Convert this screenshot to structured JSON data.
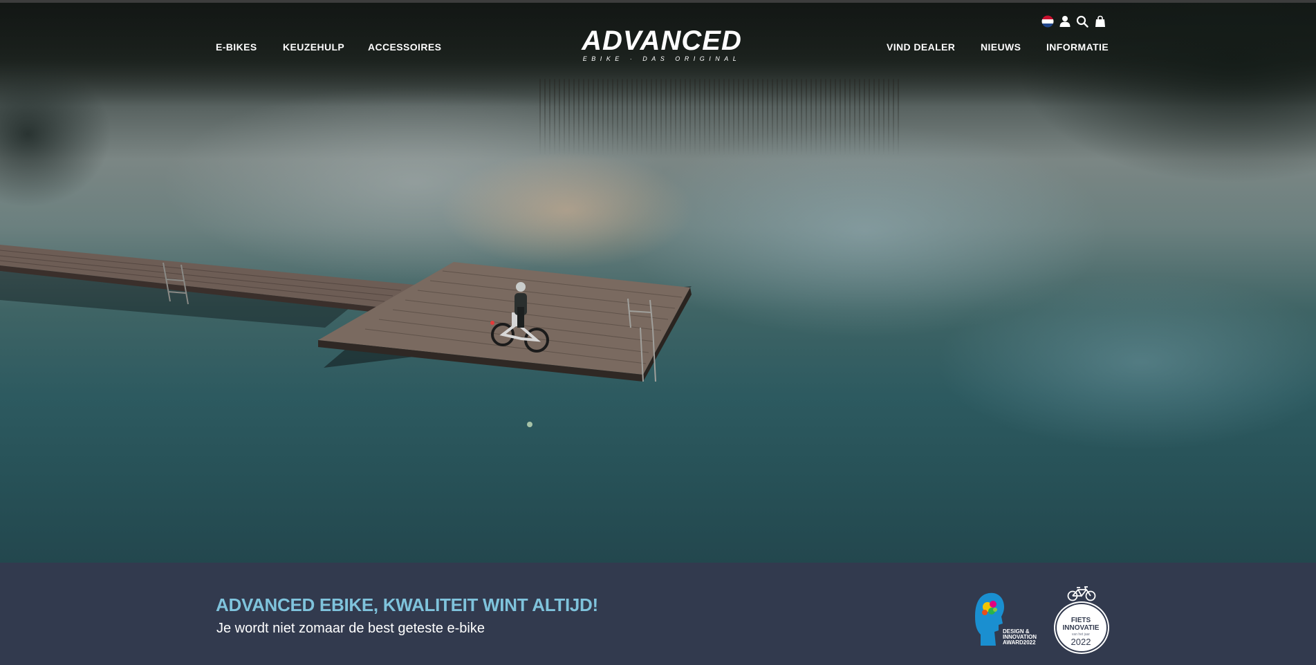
{
  "nav": {
    "left": [
      {
        "label": "E-BIKES"
      },
      {
        "label": "KEUZEHULP"
      },
      {
        "label": "ACCESSOIRES"
      }
    ],
    "right": [
      {
        "label": "VIND DEALER"
      },
      {
        "label": "NIEUWS"
      },
      {
        "label": "INFORMATIE"
      }
    ]
  },
  "logo": {
    "wordmark": "ADVANCED",
    "tagline": "EBIKE · DAS ORIGINAL"
  },
  "header_icons": [
    "flag-nl-icon",
    "user-icon",
    "search-icon",
    "cart-icon"
  ],
  "hero": {
    "scene": "drone view of a cyclist with an e-bike on a wooden pier over a calm lake at dusk"
  },
  "banner": {
    "title": "ADVANCED EBIKE, KWALITEIT WINT ALTIJD!",
    "subtitle": "Je wordt niet zomaar de best geteste e-bike"
  },
  "awards": {
    "design": {
      "line1": "DESIGN &",
      "line2": "INNOVATION",
      "line3": "AWARD2022"
    },
    "fiets": {
      "line1": "FIETS",
      "line2": "INNOVATIE",
      "line3": "van het jaar",
      "year": "2022"
    }
  },
  "colors": {
    "banner_bg": "#323a4e",
    "accent_title": "#7fc3dc",
    "nav_text": "#ffffff"
  }
}
